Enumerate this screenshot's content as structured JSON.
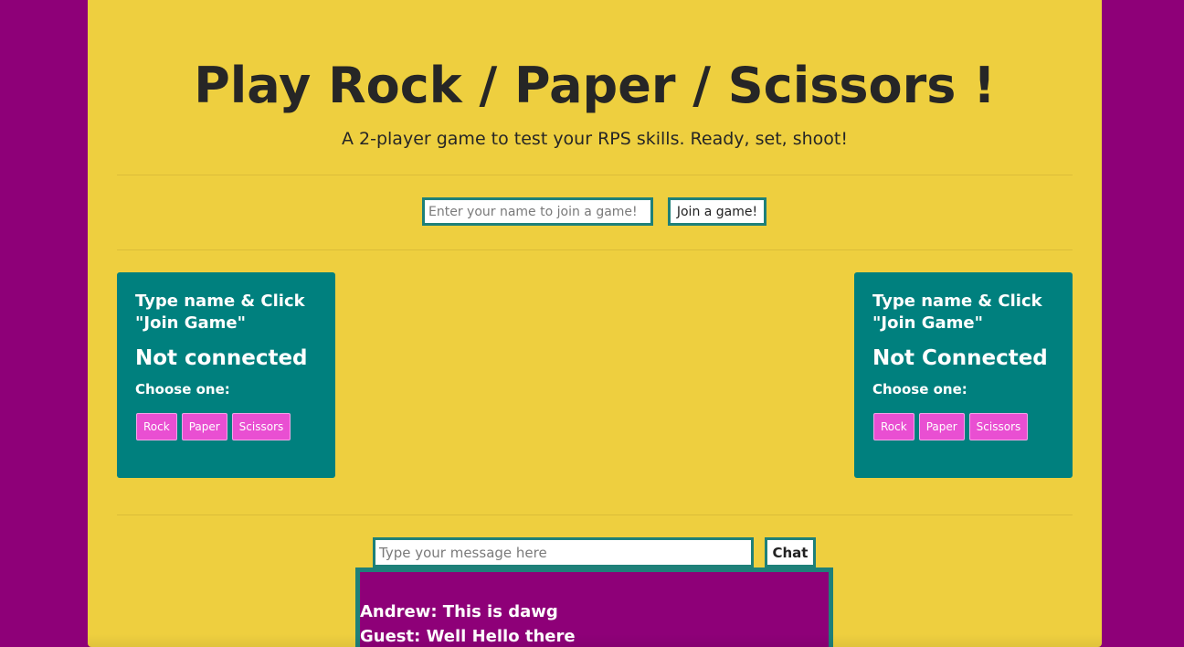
{
  "header": {
    "title": "Play Rock / Paper / Scissors !",
    "subtitle": "A 2-player game to test your RPS skills. Ready, set, shoot!"
  },
  "join": {
    "placeholder": "Enter your name to join a game!",
    "value": "",
    "button_label": "Join a game!"
  },
  "players": [
    {
      "status": "Type name & Click \"Join Game\"",
      "connection": "Not connected",
      "choose_label": "Choose one:",
      "choices": [
        "Rock",
        "Paper",
        "Scissors"
      ]
    },
    {
      "status": "Type name & Click \"Join Game\"",
      "connection": "Not Connected",
      "choose_label": "Choose one:",
      "choices": [
        "Rock",
        "Paper",
        "Scissors"
      ]
    }
  ],
  "chat": {
    "placeholder": "Type your message here",
    "value": "",
    "button_label": "Chat",
    "messages": [
      "Andrew: This is dawg",
      "Guest: Well Hello there"
    ]
  },
  "colors": {
    "page_background": "#8e0078",
    "panel": "#eecf3f",
    "card": "#00807e",
    "choice_button": "#e94fd2",
    "input_border": "#1e8079"
  }
}
